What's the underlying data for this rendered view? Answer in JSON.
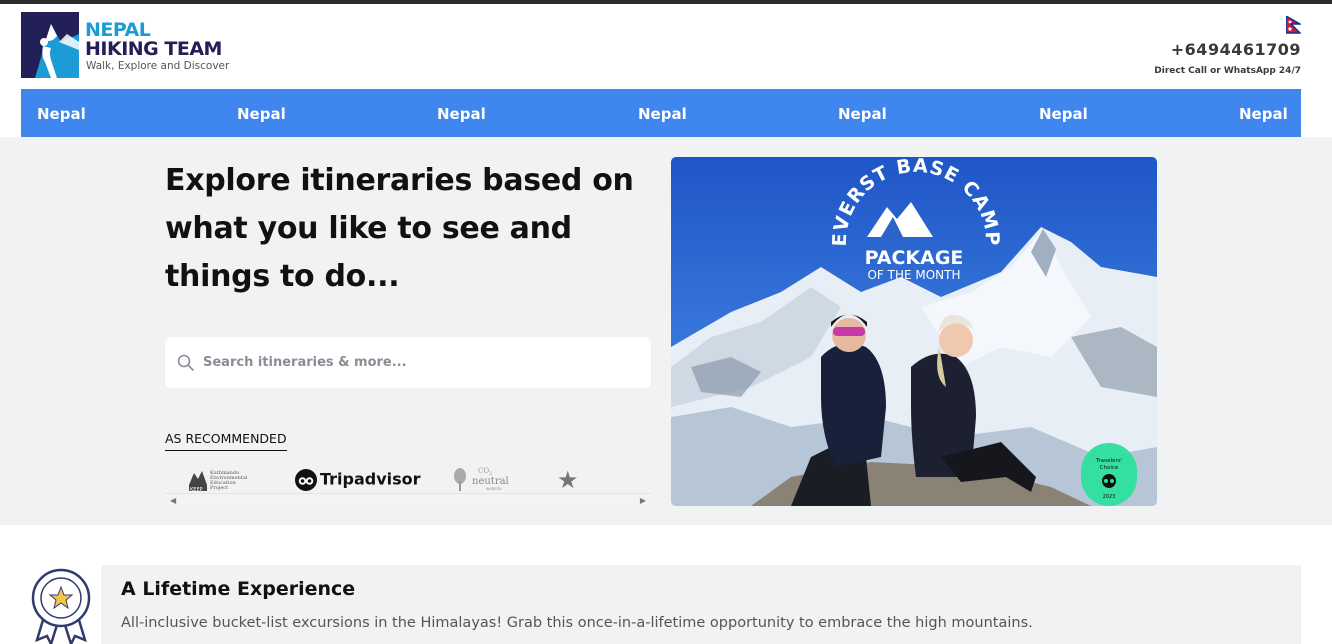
{
  "header": {
    "brand_line1": "NEPAL",
    "brand_line2": "HIKING TEAM",
    "tagline": "Walk, Explore and Discover",
    "phone": "+6494461709",
    "phone_caption": "Direct Call or WhatsApp 24/7",
    "flag_icon": "nepal-flag-icon"
  },
  "nav": {
    "items": [
      {
        "label": "Nepal"
      },
      {
        "label": "Nepal"
      },
      {
        "label": "Nepal"
      },
      {
        "label": "Nepal"
      },
      {
        "label": "Nepal"
      },
      {
        "label": "Nepal"
      },
      {
        "label": "Nepal"
      }
    ]
  },
  "hero": {
    "title": "Explore itineraries based on what you like to see and things to do...",
    "search_placeholder": "Search itineraries & more...",
    "recommended_label": "AS RECOMMENDED",
    "recommenders": {
      "keep": [
        "Kathmandu",
        "Environmental",
        "Education",
        "Project"
      ],
      "keep_abbr": "KEEP",
      "tripadvisor": "Tripadvisor",
      "co2_sup": "CO",
      "co2_sub": "2",
      "co2_word": "neutral",
      "co2_small": "website"
    }
  },
  "promo": {
    "arc_text": "EVERST BASE CAMP",
    "package_label": "PACKAGE",
    "month_label": "OF THE MONTH",
    "badge_line1": "Travelers'",
    "badge_line2": "Choice",
    "badge_year": "2023"
  },
  "feature": {
    "title": "A Lifetime Experience",
    "description": "All-inclusive bucket-list excursions in the Himalayas! Grab this once-in-a-lifetime opportunity to embrace the high mountains."
  },
  "colors": {
    "nav_bg": "#3f86ef",
    "brand_blue": "#1d9bd6",
    "brand_navy": "#231f58",
    "hero_bg": "#f1f2f4",
    "badge_green": "#34e0a1"
  }
}
